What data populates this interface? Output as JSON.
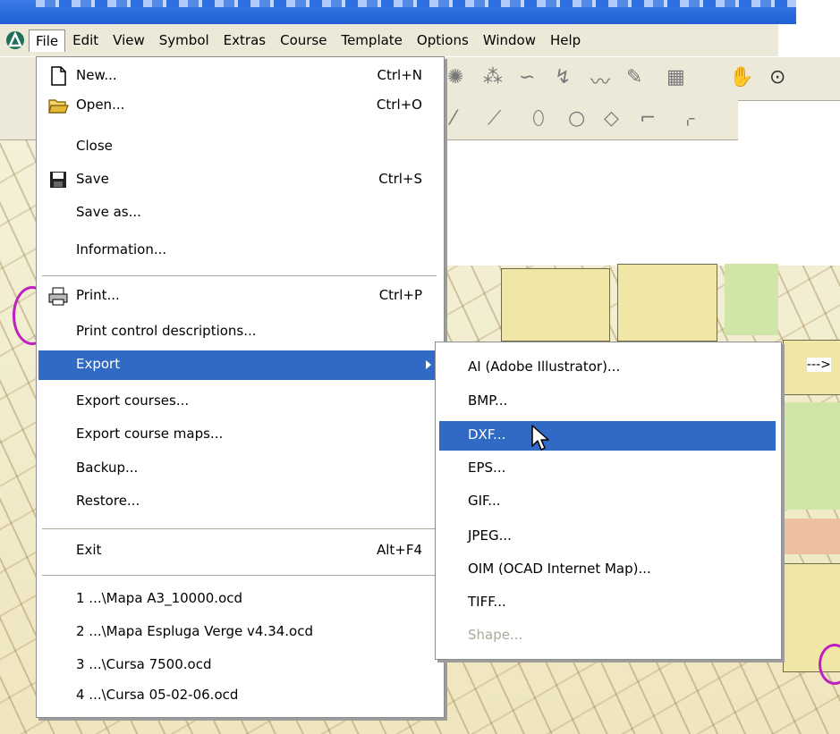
{
  "menubar": {
    "items": [
      "File",
      "Edit",
      "View",
      "Symbol",
      "Extras",
      "Course",
      "Template",
      "Options",
      "Window",
      "Help"
    ]
  },
  "file_menu": {
    "items": [
      {
        "label": "New...",
        "shortcut": "Ctrl+N",
        "icon": "new-document-icon"
      },
      {
        "label": "Open...",
        "shortcut": "Ctrl+O",
        "icon": "open-folder-icon"
      },
      {
        "label": "Close",
        "shortcut": ""
      },
      {
        "label": "Save",
        "shortcut": "Ctrl+S",
        "icon": "floppy-disk-icon"
      },
      {
        "label": "Save as...",
        "shortcut": ""
      },
      {
        "label": "Information...",
        "shortcut": ""
      },
      {
        "label": "Print...",
        "shortcut": "Ctrl+P",
        "icon": "printer-icon"
      },
      {
        "label": "Print control descriptions...",
        "shortcut": ""
      },
      {
        "label": "Export",
        "shortcut": "",
        "submenu": true,
        "highlighted": true
      },
      {
        "label": "Export courses...",
        "shortcut": ""
      },
      {
        "label": "Export course maps...",
        "shortcut": ""
      },
      {
        "label": "Backup...",
        "shortcut": ""
      },
      {
        "label": "Restore...",
        "shortcut": ""
      },
      {
        "label": "Exit",
        "shortcut": "Alt+F4"
      },
      {
        "label": "1 ...\\Mapa A3_10000.ocd"
      },
      {
        "label": "2 ...\\Mapa Espluga Verge v4.34.ocd"
      },
      {
        "label": "3 ...\\Cursa 7500.ocd"
      },
      {
        "label": "4 ...\\Cursa 05-02-06.ocd"
      }
    ]
  },
  "export_menu": {
    "items": [
      {
        "label": "AI (Adobe Illustrator)..."
      },
      {
        "label": "BMP..."
      },
      {
        "label": "DXF...",
        "highlighted": true
      },
      {
        "label": "EPS..."
      },
      {
        "label": "GIF..."
      },
      {
        "label": "JPEG..."
      },
      {
        "label": "OIM (OCAD Internet Map)..."
      },
      {
        "label": "TIFF..."
      },
      {
        "label": "Shape...",
        "disabled": true
      }
    ]
  },
  "annotation": {
    "arrow": "--->"
  },
  "colors": {
    "highlight": "#316ac5",
    "menu_bg": "#ffffff",
    "chrome": "#ece9d8",
    "titlebar": "#1f5fd3"
  }
}
